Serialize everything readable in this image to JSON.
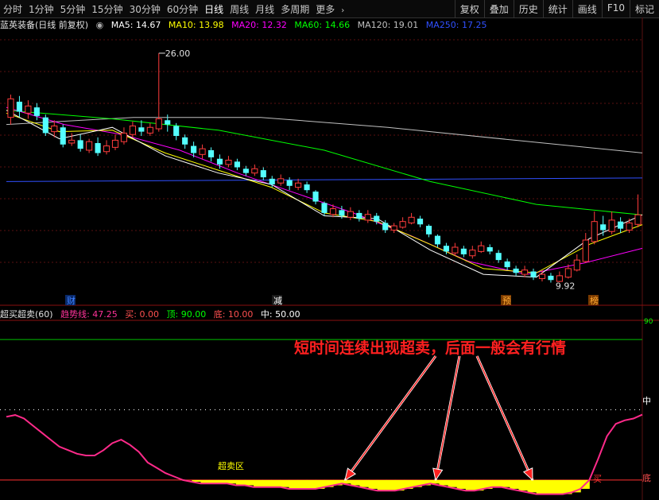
{
  "toolbar": {
    "periods": [
      "分时",
      "1分钟",
      "5分钟",
      "15分钟",
      "30分钟",
      "60分钟",
      "日线",
      "周线",
      "月线",
      "多周期",
      "更多"
    ],
    "active_period": "日线",
    "right_buttons": [
      "复权",
      "叠加",
      "历史",
      "统计",
      "画线",
      "F10",
      "标记"
    ]
  },
  "main_legend": {
    "stock": "蓝英装备(日线 前复权)",
    "ma5": "MA5: 14.67",
    "ma10": "MA10: 13.98",
    "ma20": "MA20: 12.32",
    "ma60": "MA60: 14.66",
    "ma120": "MA120: 19.01",
    "ma250": "MA250: 17.25",
    "colors": {
      "ma5": "#ffffff",
      "ma10": "#ffff00",
      "ma20": "#ff00ff",
      "ma60": "#00ff00",
      "ma120": "#c0c0c0",
      "ma250": "#3050ff"
    }
  },
  "sub_legend": {
    "name": "超买超卖(60)",
    "trend": "趋势线: 47.25",
    "buy": "买: 0.00",
    "top": "顶: 90.00",
    "bottom": "底: 10.00",
    "mid": "中: 50.00"
  },
  "annotations": {
    "headline": "短时间连续出现超卖，后面一般会有行情",
    "zone": "超卖区",
    "high_label": "26.00",
    "low_label": "9.92",
    "markers": [
      "财",
      "减",
      "预",
      "榜"
    ],
    "right_mid": "中",
    "right_bottom": "底",
    "right_top": "90",
    "buy_mark": "买"
  },
  "chart_data": {
    "type": "line",
    "price_range": [
      9.0,
      27.5
    ],
    "candles": [
      [
        21.5,
        22.8,
        23.1,
        21.0
      ],
      [
        22.6,
        21.9,
        23.0,
        21.5
      ],
      [
        21.8,
        22.3,
        22.7,
        21.4
      ],
      [
        22.2,
        21.6,
        22.5,
        21.3
      ],
      [
        21.5,
        20.4,
        21.7,
        20.2
      ],
      [
        20.5,
        20.9,
        21.3,
        20.1
      ],
      [
        20.8,
        19.6,
        21.0,
        19.4
      ],
      [
        19.7,
        19.9,
        20.4,
        19.5
      ],
      [
        19.9,
        19.3,
        20.3,
        19.1
      ],
      [
        19.2,
        19.8,
        20.0,
        19.0
      ],
      [
        19.7,
        19.0,
        20.1,
        18.8
      ],
      [
        19.1,
        19.5,
        19.9,
        18.9
      ],
      [
        19.4,
        19.9,
        20.3,
        19.2
      ],
      [
        19.8,
        20.4,
        20.8,
        19.6
      ],
      [
        20.3,
        20.9,
        21.2,
        20.1
      ],
      [
        20.8,
        20.5,
        21.3,
        20.2
      ],
      [
        20.4,
        20.8,
        21.1,
        20.2
      ],
      [
        20.7,
        21.4,
        26.0,
        20.5
      ],
      [
        21.3,
        21.0,
        21.7,
        20.5
      ],
      [
        20.9,
        20.2,
        21.1,
        19.9
      ],
      [
        20.1,
        19.6,
        20.3,
        19.3
      ],
      [
        19.5,
        19.0,
        19.8,
        18.7
      ],
      [
        18.9,
        19.3,
        19.6,
        18.6
      ],
      [
        19.2,
        18.7,
        19.4,
        18.4
      ],
      [
        18.6,
        18.2,
        18.9,
        17.9
      ],
      [
        18.2,
        18.5,
        18.8,
        18.0
      ],
      [
        18.4,
        18.0,
        18.6,
        17.8
      ],
      [
        17.9,
        17.6,
        18.1,
        17.4
      ],
      [
        17.6,
        17.9,
        18.2,
        17.4
      ],
      [
        17.8,
        17.3,
        18.0,
        17.1
      ],
      [
        17.2,
        16.8,
        17.4,
        16.6
      ],
      [
        16.9,
        17.2,
        17.5,
        16.7
      ],
      [
        17.1,
        16.7,
        17.3,
        16.4
      ],
      [
        16.6,
        16.9,
        17.2,
        16.4
      ],
      [
        16.8,
        16.4,
        17.0,
        16.2
      ],
      [
        16.3,
        15.6,
        16.4,
        15.4
      ],
      [
        15.5,
        14.8,
        15.6,
        14.6
      ],
      [
        14.7,
        15.1,
        15.4,
        14.5
      ],
      [
        15.0,
        14.6,
        15.3,
        14.4
      ],
      [
        14.5,
        14.9,
        15.2,
        14.3
      ],
      [
        14.8,
        14.4,
        15.0,
        14.2
      ],
      [
        14.3,
        14.7,
        15.0,
        14.1
      ],
      [
        14.6,
        14.2,
        14.8,
        14.0
      ],
      [
        14.1,
        13.6,
        14.3,
        13.4
      ],
      [
        13.6,
        13.9,
        14.1,
        13.4
      ],
      [
        13.8,
        14.2,
        14.5,
        13.7
      ],
      [
        14.1,
        14.5,
        14.8,
        14.0
      ],
      [
        14.4,
        14.0,
        14.6,
        13.8
      ],
      [
        13.9,
        13.3,
        14.0,
        13.1
      ],
      [
        13.2,
        12.6,
        13.3,
        12.4
      ],
      [
        12.5,
        12.1,
        12.7,
        11.9
      ],
      [
        12.0,
        12.4,
        12.7,
        11.8
      ],
      [
        12.3,
        11.9,
        12.5,
        11.7
      ],
      [
        11.8,
        12.2,
        12.5,
        11.6
      ],
      [
        12.1,
        12.5,
        12.8,
        12.0
      ],
      [
        12.4,
        12.1,
        12.6,
        11.9
      ],
      [
        12.0,
        11.5,
        12.2,
        11.3
      ],
      [
        11.4,
        11.0,
        11.6,
        10.8
      ],
      [
        10.9,
        10.6,
        11.1,
        10.4
      ],
      [
        10.5,
        10.8,
        11.1,
        10.3
      ],
      [
        10.7,
        10.3,
        10.9,
        10.1
      ],
      [
        10.2,
        10.5,
        10.8,
        10.0
      ],
      [
        10.4,
        10.1,
        10.6,
        9.92
      ],
      [
        10.0,
        10.4,
        10.7,
        9.95
      ],
      [
        10.3,
        10.9,
        11.2,
        10.2
      ],
      [
        10.8,
        11.5,
        11.9,
        10.7
      ],
      [
        11.4,
        12.9,
        13.4,
        11.3
      ],
      [
        12.8,
        14.2,
        14.9,
        12.6
      ],
      [
        14.0,
        13.6,
        14.6,
        13.2
      ],
      [
        13.5,
        14.3,
        14.9,
        13.3
      ],
      [
        14.2,
        13.7,
        14.5,
        13.4
      ],
      [
        13.6,
        14.1,
        14.4,
        13.4
      ],
      [
        14.0,
        14.67,
        16.1,
        13.8
      ]
    ],
    "series": [
      {
        "name": "MA250",
        "start": 17.0,
        "end": 17.25
      },
      {
        "name": "MA120",
        "values": [
          21.0,
          21.5,
          21.5,
          20.8,
          19.9,
          19.01
        ]
      },
      {
        "name": "MA60",
        "values": [
          22.0,
          21.4,
          20.6,
          19.2,
          17.0,
          15.4,
          14.66
        ]
      },
      {
        "name": "MA20",
        "values": [
          22.2,
          21.0,
          20.3,
          19.2,
          17.6,
          16.2,
          14.8,
          13.2,
          11.4,
          10.5,
          11.3,
          12.32
        ]
      },
      {
        "name": "MA10",
        "values": [
          21.8,
          20.5,
          20.6,
          19.0,
          17.8,
          16.6,
          14.8,
          14.2,
          12.6,
          10.9,
          10.6,
          12.6,
          13.98
        ]
      },
      {
        "name": "MA5",
        "values": [
          22.0,
          20.0,
          20.8,
          18.8,
          17.6,
          16.8,
          14.6,
          14.4,
          12.2,
          10.5,
          10.3,
          13.0,
          14.67
        ]
      }
    ],
    "oscillator": {
      "range": [
        0,
        100
      ],
      "top": 90,
      "mid": 50,
      "bottom": 10,
      "trend_values": [
        46,
        47,
        45,
        41,
        37,
        33,
        29,
        27,
        25,
        24,
        24,
        27,
        31,
        33,
        30,
        26,
        20,
        17,
        14,
        12,
        10,
        9,
        8,
        8,
        8,
        8,
        7,
        7,
        6,
        6,
        6,
        6,
        5,
        5,
        5,
        5,
        6,
        7,
        8,
        7,
        6,
        5,
        4,
        4,
        4,
        5,
        6,
        7,
        8,
        7,
        6,
        5,
        4,
        4,
        5,
        6,
        6,
        5,
        4,
        3,
        2,
        2,
        2,
        2,
        3,
        5,
        10,
        22,
        35,
        42,
        44,
        45,
        47.25
      ],
      "xlabel": "",
      "ylabel": ""
    }
  }
}
